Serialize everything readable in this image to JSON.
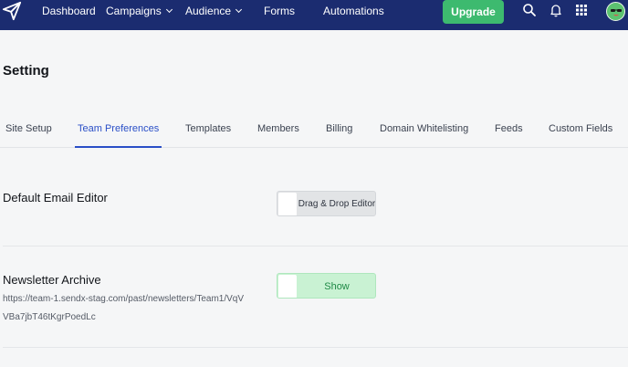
{
  "topbar": {
    "nav": [
      {
        "label": "Dashboard"
      },
      {
        "label": "Campaigns",
        "has_dropdown": true
      },
      {
        "label": "Audience",
        "has_dropdown": true
      },
      {
        "label": "Forms"
      },
      {
        "label": "Automations"
      }
    ],
    "upgrade_label": "Upgrade",
    "icons": [
      "send-logo-icon",
      "search-icon",
      "bell-icon",
      "apps-grid-icon",
      "avatar"
    ],
    "colors": {
      "bar": "#1b2c70",
      "upgrade": "#3dba6f"
    }
  },
  "page": {
    "title": "Setting"
  },
  "tabs": {
    "items": [
      {
        "label": "Site Setup"
      },
      {
        "label": "Team Preferences",
        "active": true
      },
      {
        "label": "Templates"
      },
      {
        "label": "Members"
      },
      {
        "label": "Billing"
      },
      {
        "label": "Domain Whitelisting"
      },
      {
        "label": "Feeds"
      },
      {
        "label": "Custom Fields"
      }
    ],
    "active_color": "#2a4fc7"
  },
  "settings": {
    "default_editor": {
      "label": "Default Email Editor",
      "toggle_label": "Drag & Drop Editor"
    },
    "newsletter_archive": {
      "label": "Newsletter Archive",
      "url": "https://team-1.sendx-stag.com/past/newsletters/Team1/VqVVBa7jbT46tKgrPoedLc",
      "toggle_label": "Show",
      "toggle_color": "#c9f2d3"
    }
  }
}
